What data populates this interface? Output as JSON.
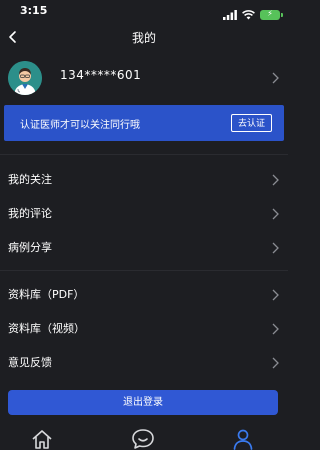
{
  "status_bar": {
    "time": "3:15",
    "battery_color": "#57c25a"
  },
  "nav": {
    "title": "我的"
  },
  "profile": {
    "phone": "134*****601"
  },
  "banner": {
    "text": "认证医师才可以关注同行哦",
    "button_label": "去认证",
    "color": "#2b53c9"
  },
  "menu": {
    "items": [
      {
        "label": "我的关注"
      },
      {
        "label": "我的评论"
      },
      {
        "label": "病例分享"
      },
      {
        "label": "资料库（PDF）"
      },
      {
        "label": "资料库（视频）"
      },
      {
        "label": "意见反馈"
      }
    ]
  },
  "logout": {
    "label": "退出登录",
    "color": "#3058d4"
  },
  "tabbar": {
    "tabs": [
      {
        "icon": "home-icon",
        "active": false
      },
      {
        "icon": "chat-smile-icon",
        "active": false
      },
      {
        "icon": "user-icon",
        "active": true
      }
    ],
    "active_color": "#3a7bf0"
  }
}
